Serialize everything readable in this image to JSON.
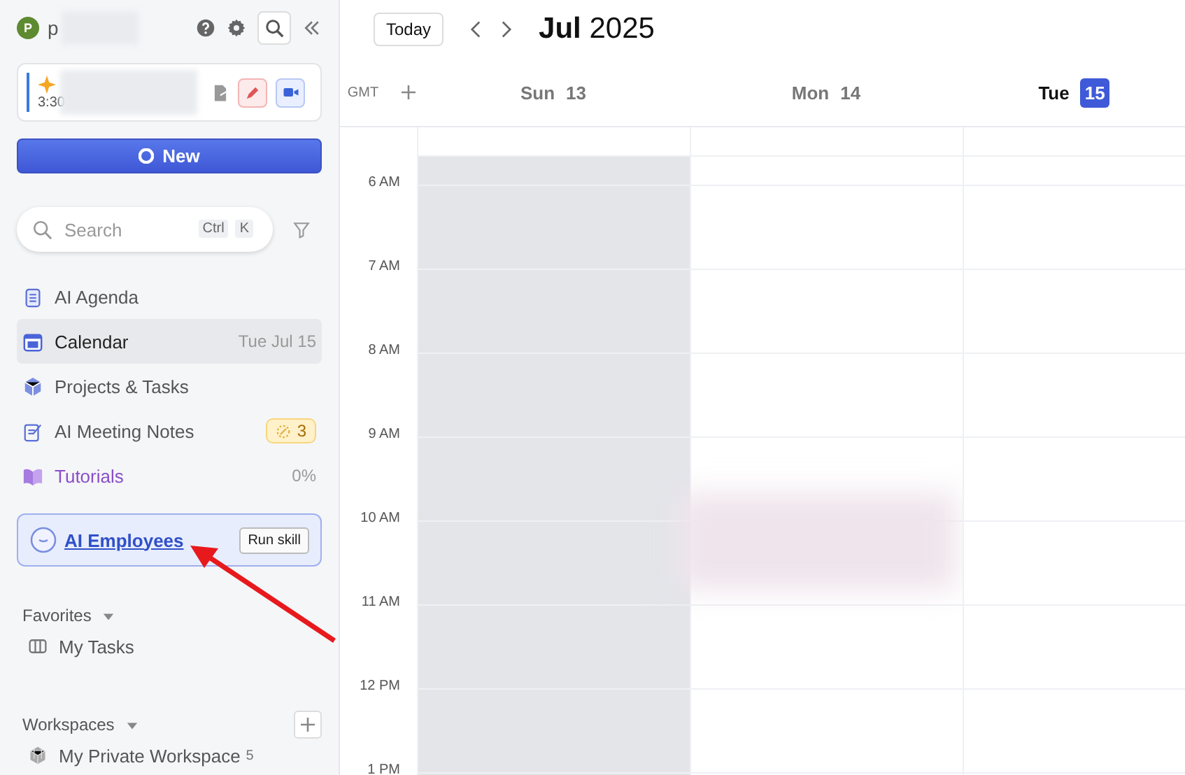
{
  "sidebar": {
    "user": {
      "avatar_letter": "P",
      "name": "p"
    },
    "event_card": {
      "time": "3:30"
    },
    "new_button": "New",
    "search": {
      "placeholder": "Search",
      "shortcut": [
        "Ctrl",
        "K"
      ]
    },
    "nav_items": [
      {
        "kind": "agenda",
        "label": "AI Agenda",
        "selected": false
      },
      {
        "kind": "calendar",
        "label": "Calendar",
        "meta": "Tue Jul 15",
        "selected": true
      },
      {
        "kind": "projects",
        "label": "Projects & Tasks",
        "selected": false
      },
      {
        "kind": "notes",
        "label": "AI Meeting Notes",
        "badge": "3",
        "selected": false
      },
      {
        "kind": "tutorials",
        "label": "Tutorials",
        "meta": "0%",
        "selected": false
      }
    ],
    "ai_employees": {
      "label": "AI Employees",
      "button": "Run skill"
    },
    "favorites": {
      "title": "Favorites",
      "expanded": true,
      "items": [
        {
          "label": "My Tasks"
        }
      ]
    },
    "workspaces": {
      "title": "Workspaces",
      "expanded": true,
      "items": [
        {
          "label": "My Private Workspace",
          "count": "5"
        }
      ]
    }
  },
  "calendar": {
    "today_button": "Today",
    "month": "Jul",
    "year": "2025",
    "timezone": "GMT",
    "days": [
      {
        "weekday": "Sun",
        "date": "13",
        "past": true,
        "selected": false
      },
      {
        "weekday": "Mon",
        "date": "14",
        "past": false,
        "selected": false
      },
      {
        "weekday": "Tue",
        "date": "15",
        "past": false,
        "selected": true
      }
    ],
    "hours": [
      "6 AM",
      "7 AM",
      "8 AM",
      "9 AM",
      "10 AM",
      "11 AM",
      "12 PM",
      "1 PM"
    ]
  }
}
